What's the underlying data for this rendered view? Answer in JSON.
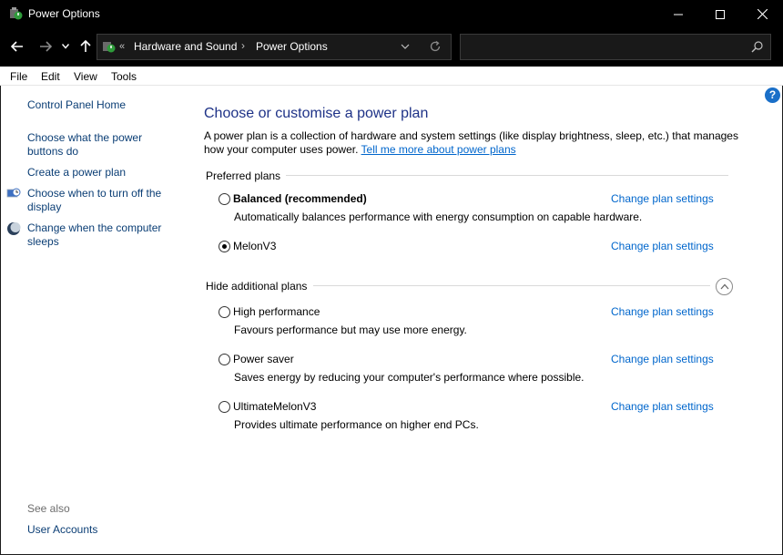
{
  "window": {
    "title": "Power Options",
    "controls": {
      "minimize": "minimize-icon",
      "maximize": "maximize-icon",
      "close": "close-icon"
    }
  },
  "address": {
    "overflow": "«",
    "crumbs": [
      "Hardware and Sound",
      "Power Options"
    ],
    "separator": "›",
    "search_placeholder": ""
  },
  "menu": [
    "File",
    "Edit",
    "View",
    "Tools"
  ],
  "left_pane": {
    "home": "Control Panel Home",
    "links": [
      "Choose what the power buttons do",
      "Create a power plan",
      "Choose when to turn off the display",
      "Change when the computer sleeps"
    ],
    "see_also": "See also",
    "see_also_links": [
      "User Accounts"
    ]
  },
  "main": {
    "title": "Choose or customise a power plan",
    "intro": "A power plan is a collection of hardware and system settings (like display brightness, sleep, etc.) that manages how your computer uses power.",
    "intro_link": "Tell me more about power plans",
    "preferred_header": "Preferred plans",
    "additional_header": "Hide additional plans",
    "plans": [
      {
        "name": "Balanced (recommended)",
        "description": "Automatically balances performance with energy consumption on capable hardware.",
        "selected": false,
        "link": "Change plan settings"
      },
      {
        "name": "MelonV3",
        "description": "",
        "selected": true,
        "link": "Change plan settings"
      },
      {
        "name": "High performance",
        "description": "Favours performance but may use more energy.",
        "selected": false,
        "link": "Change plan settings"
      },
      {
        "name": "Power saver",
        "description": "Saves energy by reducing your computer's performance where possible.",
        "selected": false,
        "link": "Change plan settings"
      },
      {
        "name": "UltimateMelonV3",
        "description": "Provides ultimate performance on higher end PCs.",
        "selected": false,
        "link": "Change plan settings"
      }
    ]
  },
  "help": "?",
  "colors": {
    "accent_link": "#0066cc",
    "title_blue": "#1e3287",
    "chrome": "#000000"
  }
}
